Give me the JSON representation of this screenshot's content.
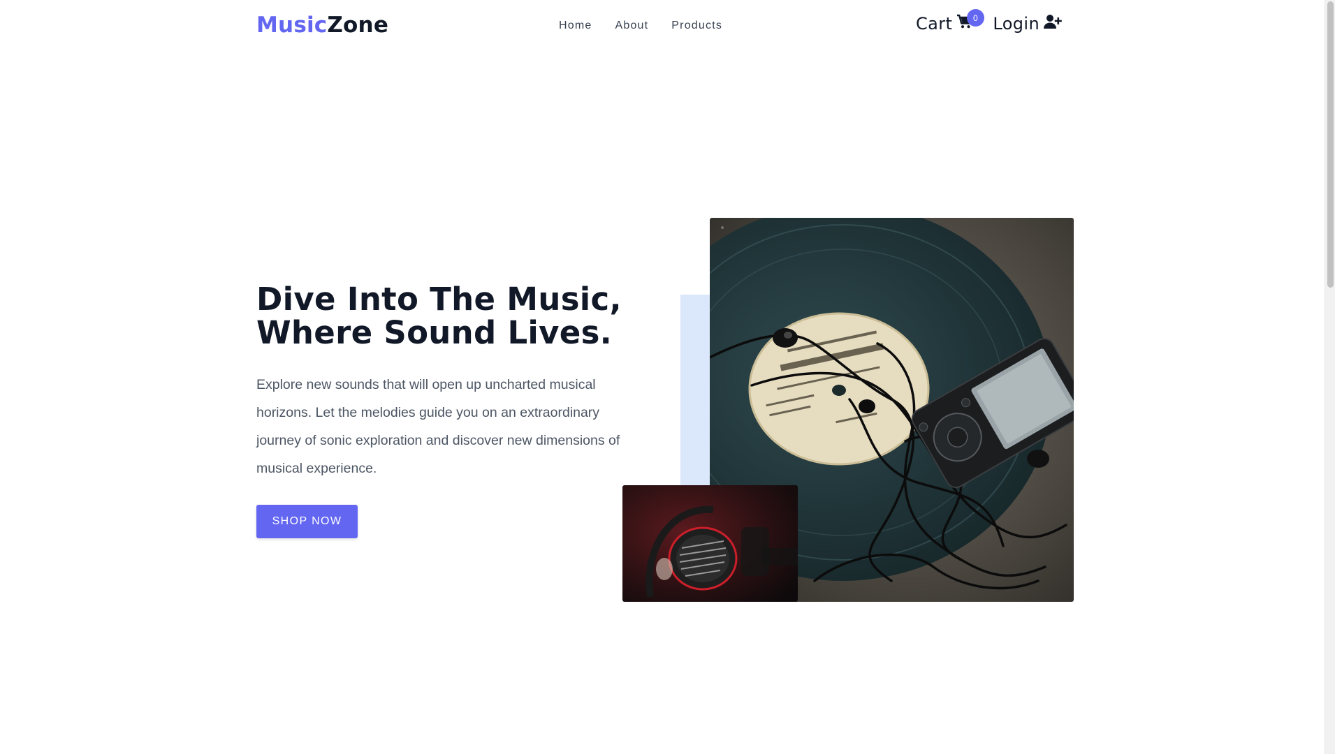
{
  "brand": {
    "part1": "Music",
    "part2": "Zone"
  },
  "nav": {
    "links": [
      {
        "label": "Home"
      },
      {
        "label": "About"
      },
      {
        "label": "Products"
      }
    ]
  },
  "cart": {
    "label": "Cart",
    "count": "0",
    "icon": "cart-icon"
  },
  "login": {
    "label": "Login",
    "icon": "user-plus-icon"
  },
  "hero": {
    "title_line1": "Dive Into The Music,",
    "title_line2": "Where Sound Lives.",
    "description": "Explore new sounds that will open up uncharted musical horizons. Let the melodies guide you on an extraordinary journey of sonic exploration and discover new dimensions of musical experience.",
    "cta_label": "SHOP NOW"
  },
  "colors": {
    "accent": "#6366f1",
    "text_dark": "#111827",
    "text_muted": "#4b5563",
    "accent_block": "#dbe7fb"
  }
}
